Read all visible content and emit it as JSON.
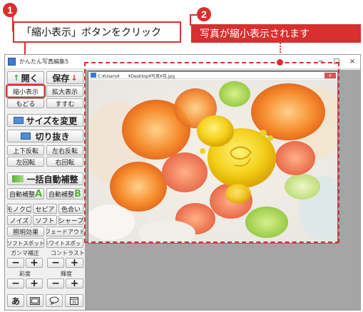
{
  "callouts": {
    "one_number": "1",
    "one_text": "「縮小表示」ボタンをクリック",
    "two_number": "2",
    "two_text": "写真が縮小表示されます"
  },
  "window": {
    "title": "かんたん写真編集5",
    "minimize": "−",
    "maximize": "□",
    "close": "×"
  },
  "toolbar": {
    "open": "開く",
    "save": "保存",
    "shrink": "縮小表示",
    "enlarge": "拡大表示",
    "undo": "もどる",
    "redo": "すすむ",
    "resize": "サイズを変更",
    "crop": "切り抜き",
    "flip_vertical": "上下反転",
    "flip_horizontal": "左右反転",
    "rotate_left": "左回転",
    "rotate_right": "右回転",
    "auto_correct_all": "一括自動補整",
    "auto_correct_a": "自動補整",
    "auto_correct_a_letter": "A",
    "auto_correct_b": "自動補整",
    "auto_correct_b_letter": "B",
    "mono": "モノクロ",
    "sepia": "セピア",
    "tint": "色合い",
    "noise": "ノイズ",
    "soft": "ソフト",
    "sharp": "シャープ",
    "lighting": "照明効果",
    "fade_out": "フェードアウト",
    "soft_spot": "ソフトスポット",
    "white_spot": "ホワイトスポット",
    "gamma_label": "ガンマ補正",
    "contrast_label": "コントラスト",
    "saturation_label": "彩度",
    "brightness_label": "輝度",
    "minus": "−",
    "plus": "+",
    "text_tool": "あ"
  },
  "image_window": {
    "path": "C:¥Users¥　　¥Desktop¥写真¥花.jpg",
    "close": "×"
  },
  "colors": {
    "callout_red": "#d7302f",
    "auto_a_green": "#55b436",
    "auto_b_green": "#55b436"
  },
  "icons": [
    "open-arrow-icon",
    "save-arrow-icon",
    "resize-icon",
    "crop-icon",
    "auto-correct-icon",
    "text-icon",
    "frame-icon",
    "speech-bubble-icon",
    "calendar-icon"
  ]
}
